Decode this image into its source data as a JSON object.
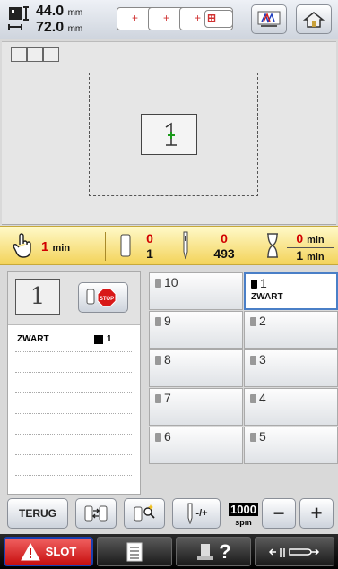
{
  "design_size": {
    "width": "44.0",
    "height": "72.0",
    "unit": "mm"
  },
  "icons": {
    "size": "design-size-icon",
    "hoop": "embroidery-frame-icon",
    "stitch_view": "stitch-view-icon",
    "home": "home-icon",
    "hand": "hand-touch-icon",
    "spool": "thread-spool-icon",
    "needle": "needle-icon",
    "hourglass": "hourglass-icon",
    "stop": "stop-sign-icon",
    "warning": "warning-icon"
  },
  "time_bar": {
    "hand_time": "1",
    "hand_unit": "min",
    "color_current": "0",
    "color_total": "1",
    "stitch_current": "0",
    "stitch_total": "493",
    "time_current": "0",
    "time_total": "1",
    "time_unit": "min"
  },
  "design_thumb": "1",
  "color_list": [
    {
      "name": "ZWART",
      "index": "1"
    }
  ],
  "needles": [
    {
      "label": "10"
    },
    {
      "label": "1",
      "color_name": "ZWART",
      "active": true
    },
    {
      "label": "9"
    },
    {
      "label": "2"
    },
    {
      "label": "8"
    },
    {
      "label": "3"
    },
    {
      "label": "7"
    },
    {
      "label": "4"
    },
    {
      "label": "6"
    },
    {
      "label": "5"
    }
  ],
  "buttons": {
    "back": "TERUG",
    "adjust": "-/+",
    "speed_value": "1000",
    "speed_unit": "spm",
    "minus": "−",
    "plus": "+"
  },
  "status": {
    "slot_label": "SLOT",
    "help": "?"
  },
  "colors": {
    "accent_red": "#d10000",
    "slot_red": "#c81010",
    "active_blue": "#4a7fc7",
    "time_bar_yellow": "#f3d35a"
  }
}
